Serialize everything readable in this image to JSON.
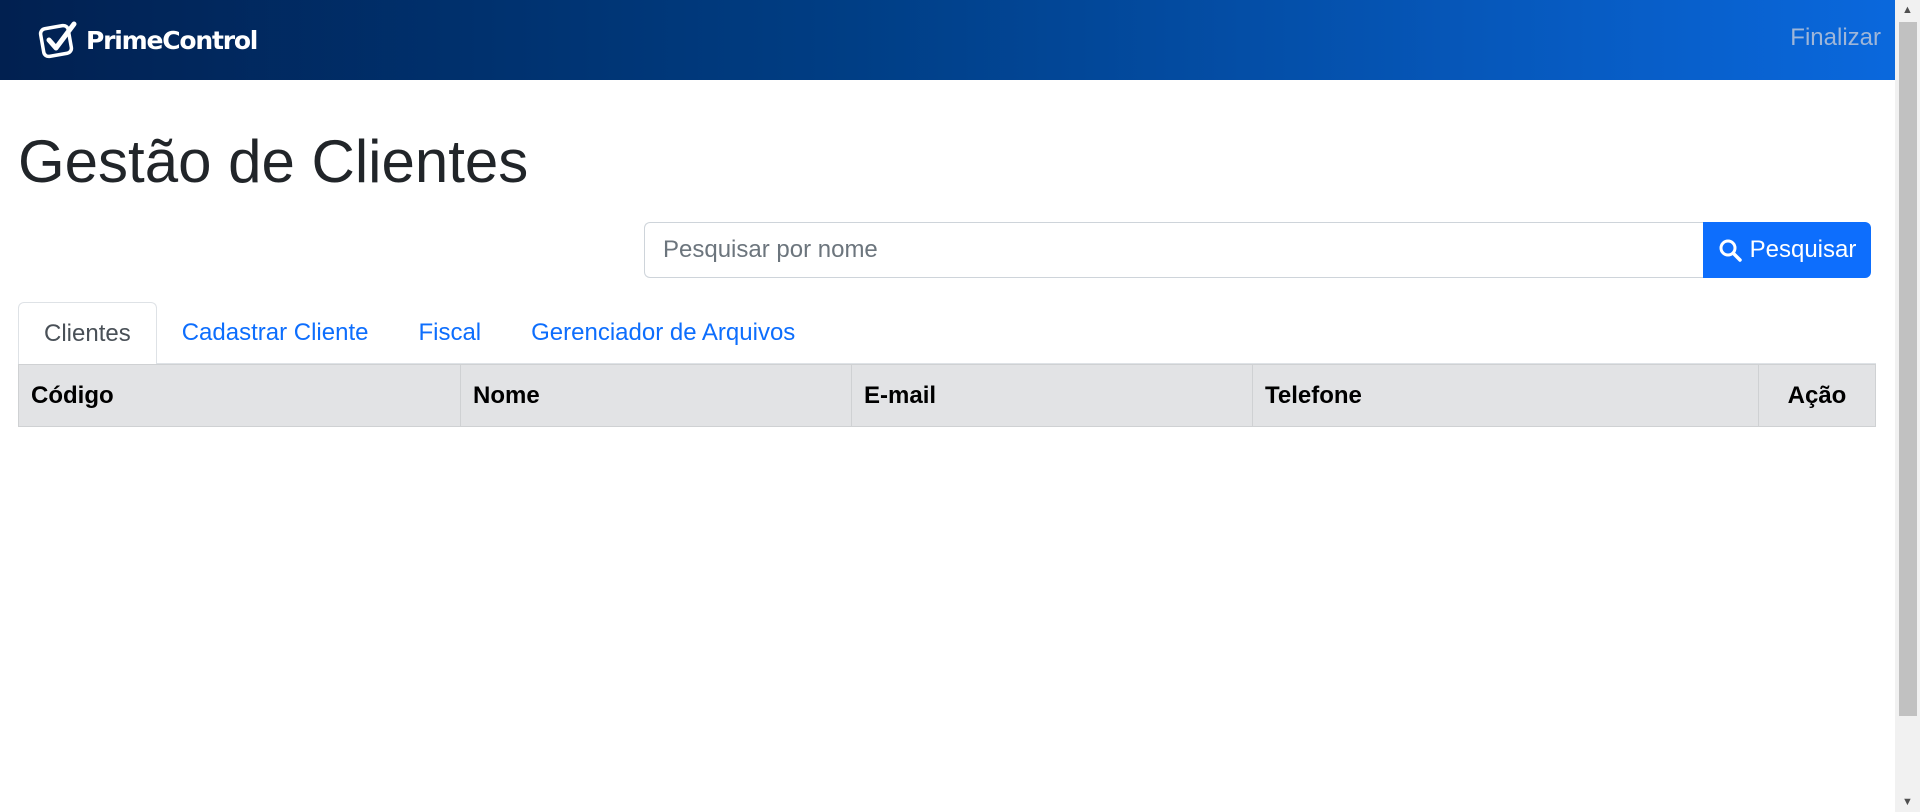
{
  "navbar": {
    "brand": "PrimeControl",
    "logout_label": "Finalizar",
    "logo_icon": "check-badge-icon"
  },
  "page": {
    "title": "Gestão de Clientes"
  },
  "search": {
    "placeholder": "Pesquisar por nome",
    "value": "",
    "button_label": "Pesquisar",
    "button_icon": "search-icon"
  },
  "tabs": [
    {
      "label": "Clientes",
      "active": true
    },
    {
      "label": "Cadastrar Cliente",
      "active": false
    },
    {
      "label": "Fiscal",
      "active": false
    },
    {
      "label": "Gerenciador de Arquivos",
      "active": false
    }
  ],
  "table": {
    "columns": [
      "Código",
      "Nome",
      "E-mail",
      "Telefone",
      "Ação"
    ],
    "rows": []
  },
  "colors": {
    "primary": "#0d6efd",
    "navbar_start": "#012050",
    "navbar_end": "#0a68dd",
    "table_header_bg": "#e2e3e5",
    "title_text": "#212529"
  }
}
